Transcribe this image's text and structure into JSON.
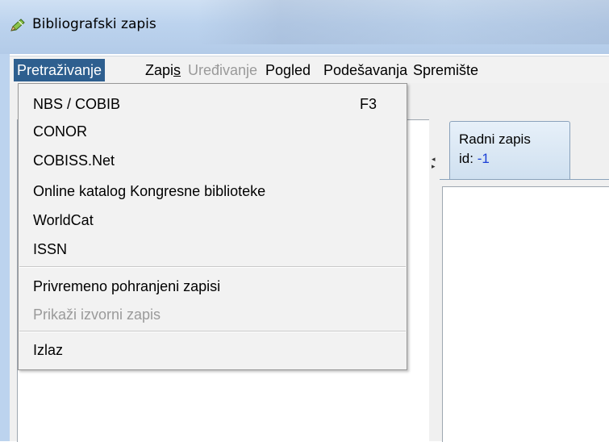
{
  "window": {
    "title": "Bibliografski zapis",
    "icon": "pencil-icon"
  },
  "menubar": {
    "items": [
      {
        "label": "Pretraživanje",
        "state": "active"
      },
      {
        "label": "Zapis",
        "state": "enabled",
        "mnemonic": "s"
      },
      {
        "label": "Uređivanje",
        "state": "disabled"
      },
      {
        "label": "Pogled",
        "state": "enabled"
      },
      {
        "label": "Podešavanja",
        "state": "enabled"
      },
      {
        "label": "Spremište",
        "state": "enabled"
      }
    ]
  },
  "dropdown": {
    "items": [
      {
        "label": "NBS / COBIB",
        "shortcut": "F3",
        "disabled": false
      },
      {
        "label": "CONOR",
        "disabled": false
      },
      {
        "label": "COBISS.Net",
        "disabled": false
      },
      {
        "label": "Online katalog Kongresne biblioteke",
        "disabled": false
      },
      {
        "label": "WorldCat",
        "disabled": false
      },
      {
        "label": "ISSN",
        "disabled": false
      },
      {
        "label": "Privremeno pohranjeni zapisi",
        "disabled": false
      },
      {
        "label": "Prikaži izvorni zapis",
        "disabled": true
      },
      {
        "label": "Izlaz",
        "disabled": false
      }
    ]
  },
  "tab": {
    "label": "Radni zapis",
    "id_label": "id:",
    "id_value": "-1"
  },
  "colors": {
    "active_menu_bg": "#2e5f8f",
    "disabled_text": "#9a9a9a",
    "id_value": "#1a3fd6"
  }
}
